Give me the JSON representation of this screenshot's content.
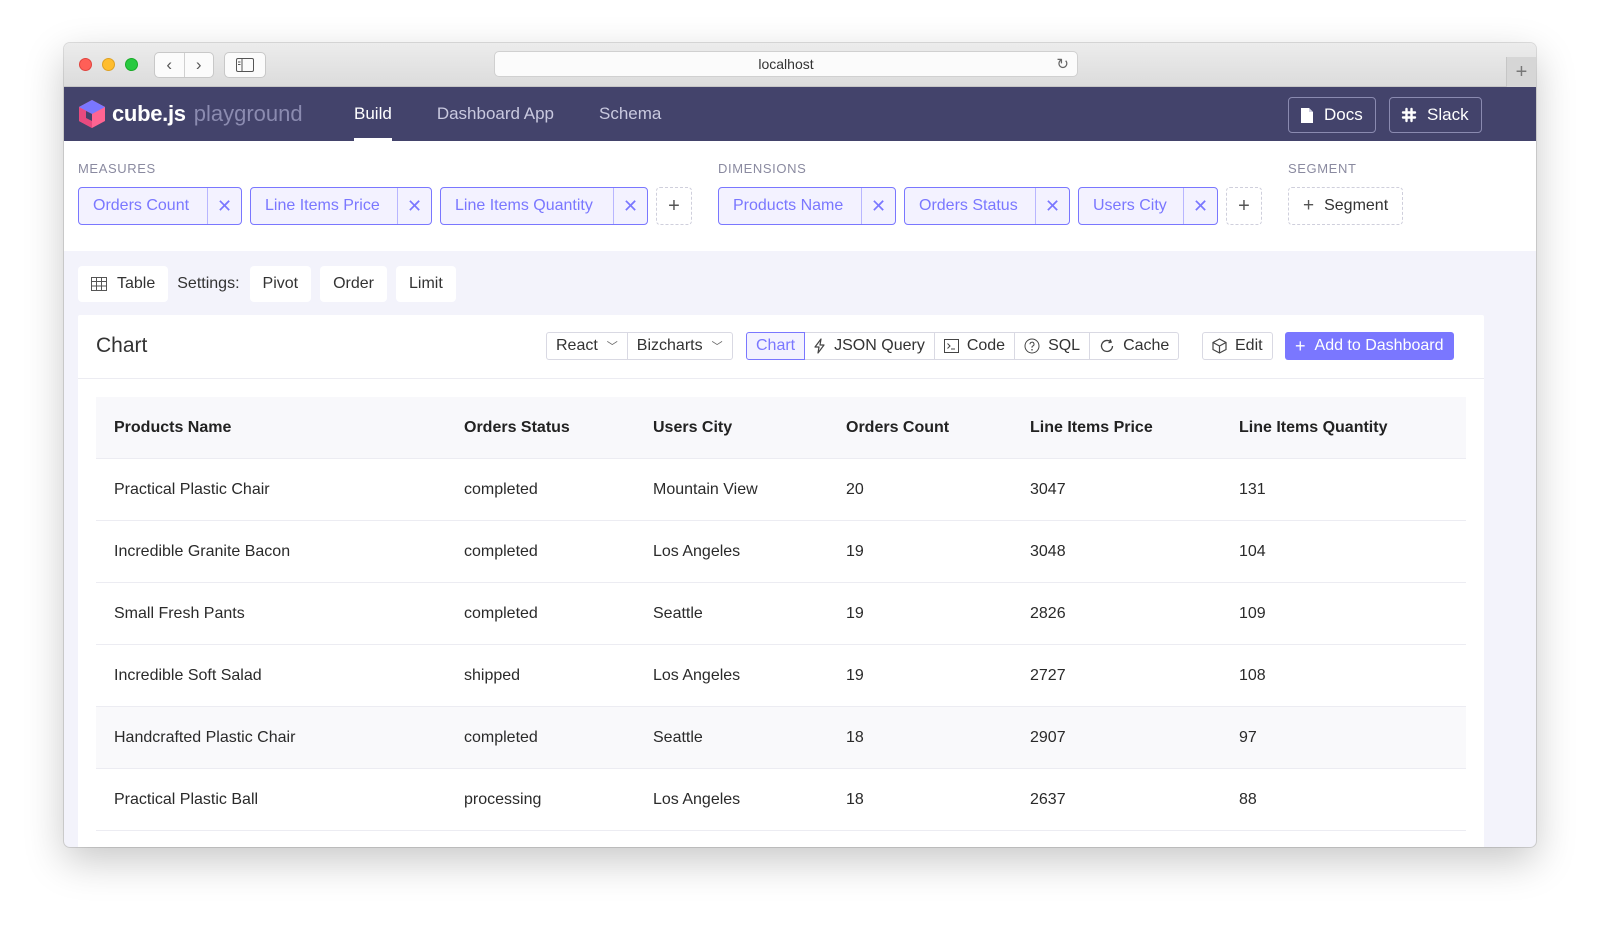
{
  "browser": {
    "url": "localhost"
  },
  "header": {
    "brand": "cube.js",
    "brand_sub": "playground",
    "nav": [
      "Build",
      "Dashboard App",
      "Schema"
    ],
    "docs_label": "Docs",
    "slack_label": "Slack"
  },
  "builder": {
    "measures_label": "MEASURES",
    "measures": [
      "Orders Count",
      "Line Items Price",
      "Line Items Quantity"
    ],
    "dimensions_label": "DIMENSIONS",
    "dimensions": [
      "Products Name",
      "Orders Status",
      "Users City"
    ],
    "segment_label": "SEGMENT",
    "segment_button": "Segment"
  },
  "settings": {
    "chart_type": "Table",
    "label": "Settings:",
    "buttons": [
      "Pivot",
      "Order",
      "Limit"
    ]
  },
  "card": {
    "title": "Chart",
    "framework": "React",
    "library": "Bizcharts",
    "tabs": [
      "Chart",
      "JSON Query",
      "Code",
      "SQL",
      "Cache"
    ],
    "edit": "Edit",
    "add": "Add to Dashboard"
  },
  "table": {
    "columns": [
      "Products Name",
      "Orders Status",
      "Users City",
      "Orders Count",
      "Line Items Price",
      "Line Items Quantity"
    ],
    "rows": [
      [
        "Practical Plastic Chair",
        "completed",
        "Mountain View",
        "20",
        "3047",
        "131"
      ],
      [
        "Incredible Granite Bacon",
        "completed",
        "Los Angeles",
        "19",
        "3048",
        "104"
      ],
      [
        "Small Fresh Pants",
        "completed",
        "Seattle",
        "19",
        "2826",
        "109"
      ],
      [
        "Incredible Soft Salad",
        "shipped",
        "Los Angeles",
        "19",
        "2727",
        "108"
      ],
      [
        "Handcrafted Plastic Chair",
        "completed",
        "Seattle",
        "18",
        "2907",
        "97"
      ],
      [
        "Practical Plastic Ball",
        "processing",
        "Los Angeles",
        "18",
        "2637",
        "88"
      ]
    ]
  },
  "colors": {
    "header_bg": "#43436b",
    "accent": "#7a77ff"
  }
}
